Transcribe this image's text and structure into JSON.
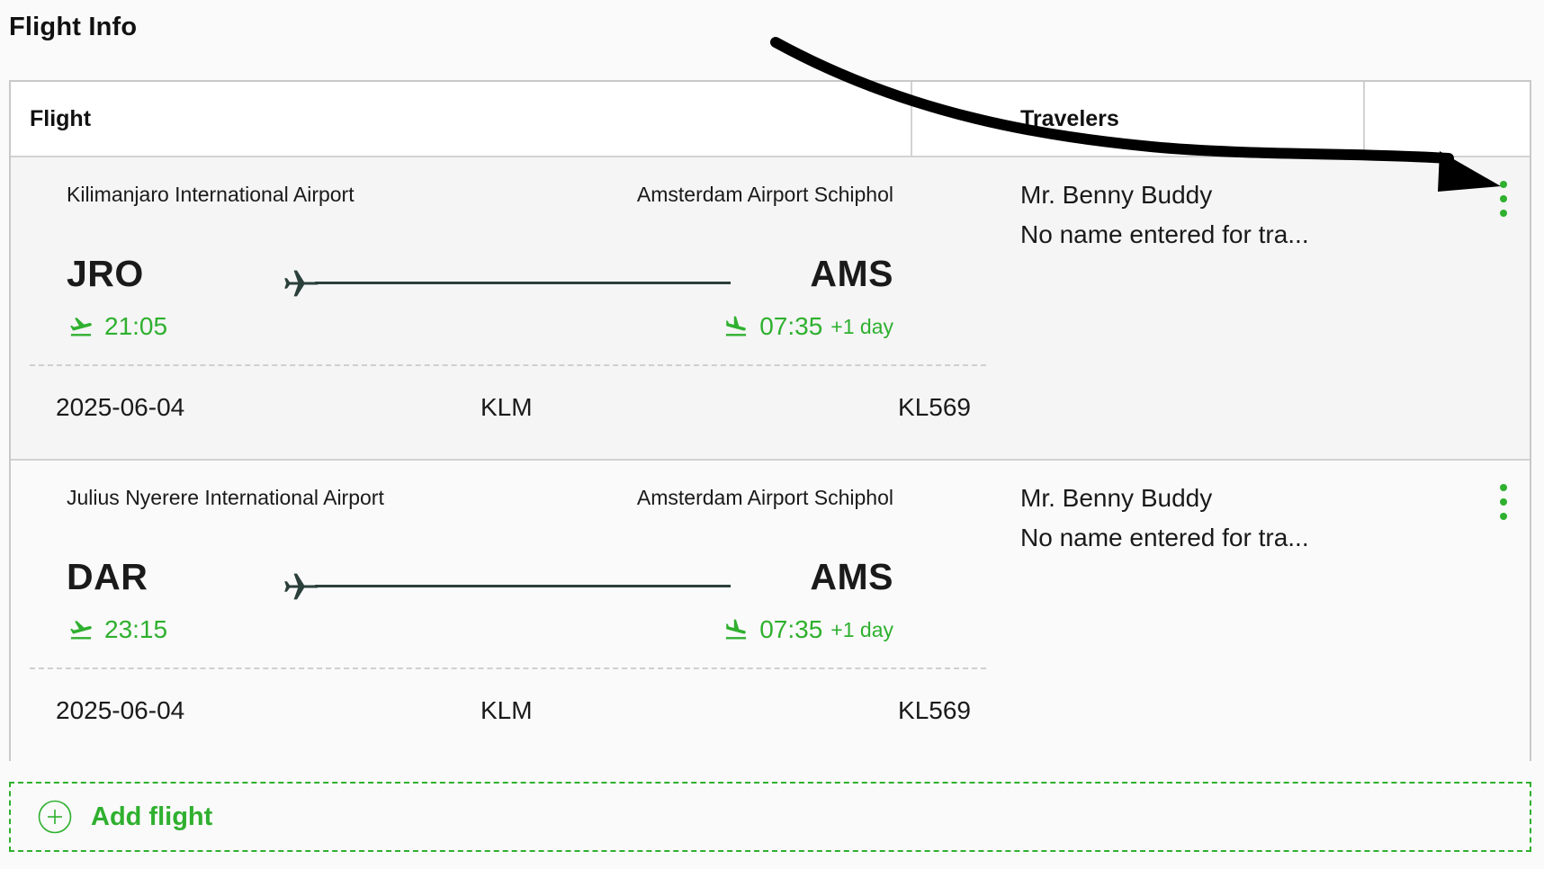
{
  "section_title": "Flight Info",
  "table": {
    "headers": {
      "flight": "Flight",
      "travelers": "Travelers"
    },
    "rows": [
      {
        "departure_airport": "Kilimanjaro International Airport",
        "arrival_airport": "Amsterdam Airport Schiphol",
        "departure_code": "JRO",
        "arrival_code": "AMS",
        "departure_time": "21:05",
        "arrival_time": "07:35",
        "arrival_day_offset": "+1 day",
        "date": "2025-06-04",
        "airline": "KLM",
        "flight_number": "KL569",
        "travelers": [
          "Mr. Benny Buddy",
          "No name entered for tra..."
        ]
      },
      {
        "departure_airport": "Julius Nyerere International Airport",
        "arrival_airport": "Amsterdam Airport Schiphol",
        "departure_code": "DAR",
        "arrival_code": "AMS",
        "departure_time": "23:15",
        "arrival_time": "07:35",
        "arrival_day_offset": "+1 day",
        "date": "2025-06-04",
        "airline": "KLM",
        "flight_number": "KL569",
        "travelers": [
          "Mr. Benny Buddy",
          "No name entered for tra..."
        ]
      }
    ]
  },
  "add_flight": {
    "label": "Add flight"
  },
  "icons": {
    "route": "airplane-icon",
    "departure": "takeoff-icon",
    "arrival": "landing-icon",
    "row_menu": "kebab-menu-icon",
    "add": "plus-circle-icon"
  },
  "colors": {
    "accent": "#2fb02f",
    "route_line": "#2b3f3b",
    "annotation_arrow": "#000000"
  }
}
